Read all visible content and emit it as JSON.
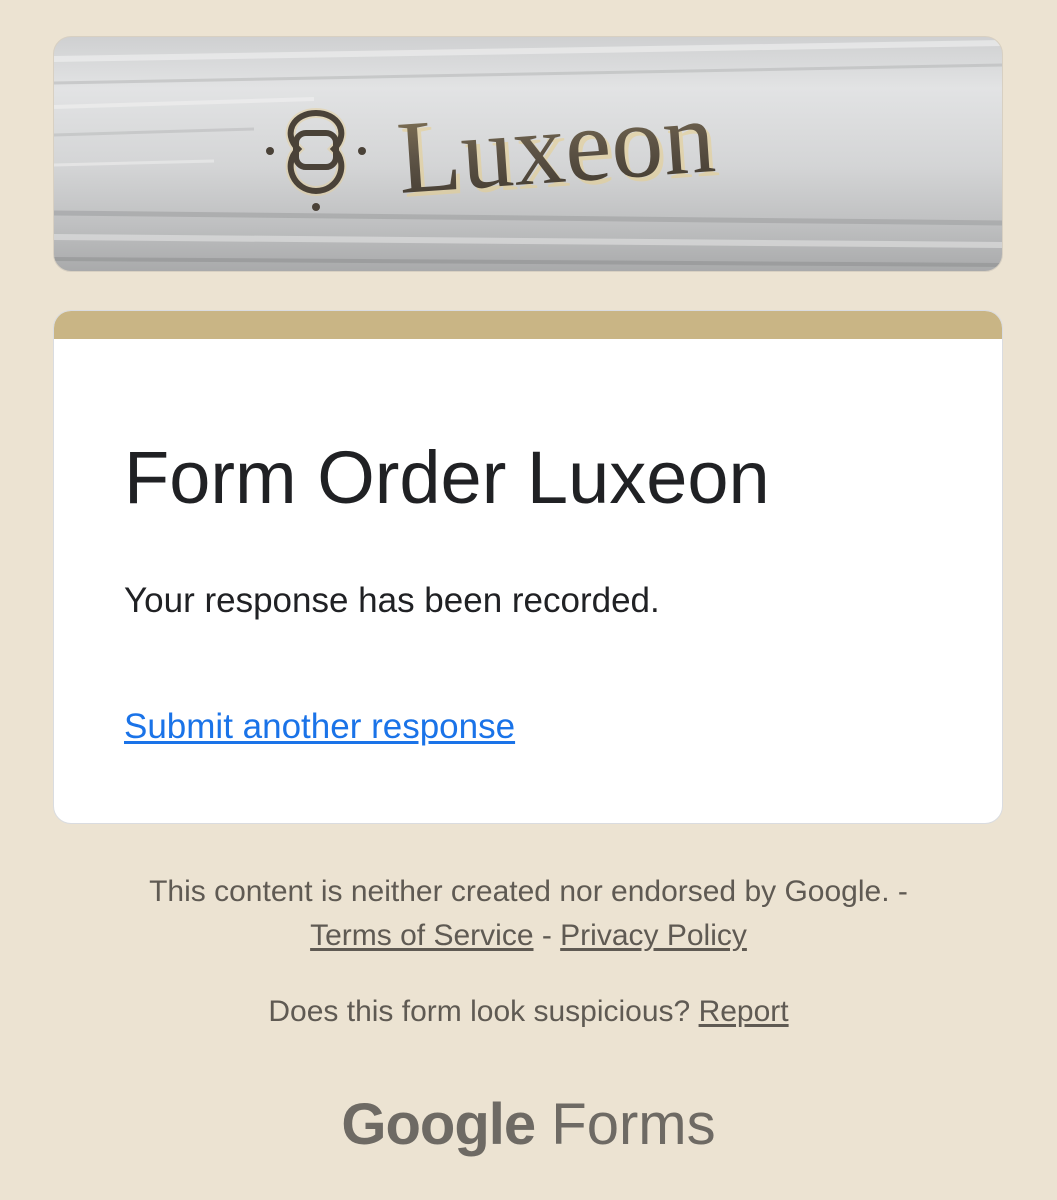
{
  "banner": {
    "brand_text": "Luxeon"
  },
  "form": {
    "accent_color": "#c9b585",
    "title": "Form Order Luxeon",
    "confirmation": "Your response has been recorded.",
    "submit_another_label": "Submit another response"
  },
  "footer": {
    "disclaimer": "This content is neither created nor endorsed by Google. -",
    "terms_label": "Terms of Service",
    "separator": " - ",
    "privacy_label": "Privacy Policy",
    "suspicious_text": "Does this form look suspicious? ",
    "report_label": "Report"
  },
  "logo": {
    "google_text": "Google",
    "forms_text": "Forms"
  }
}
